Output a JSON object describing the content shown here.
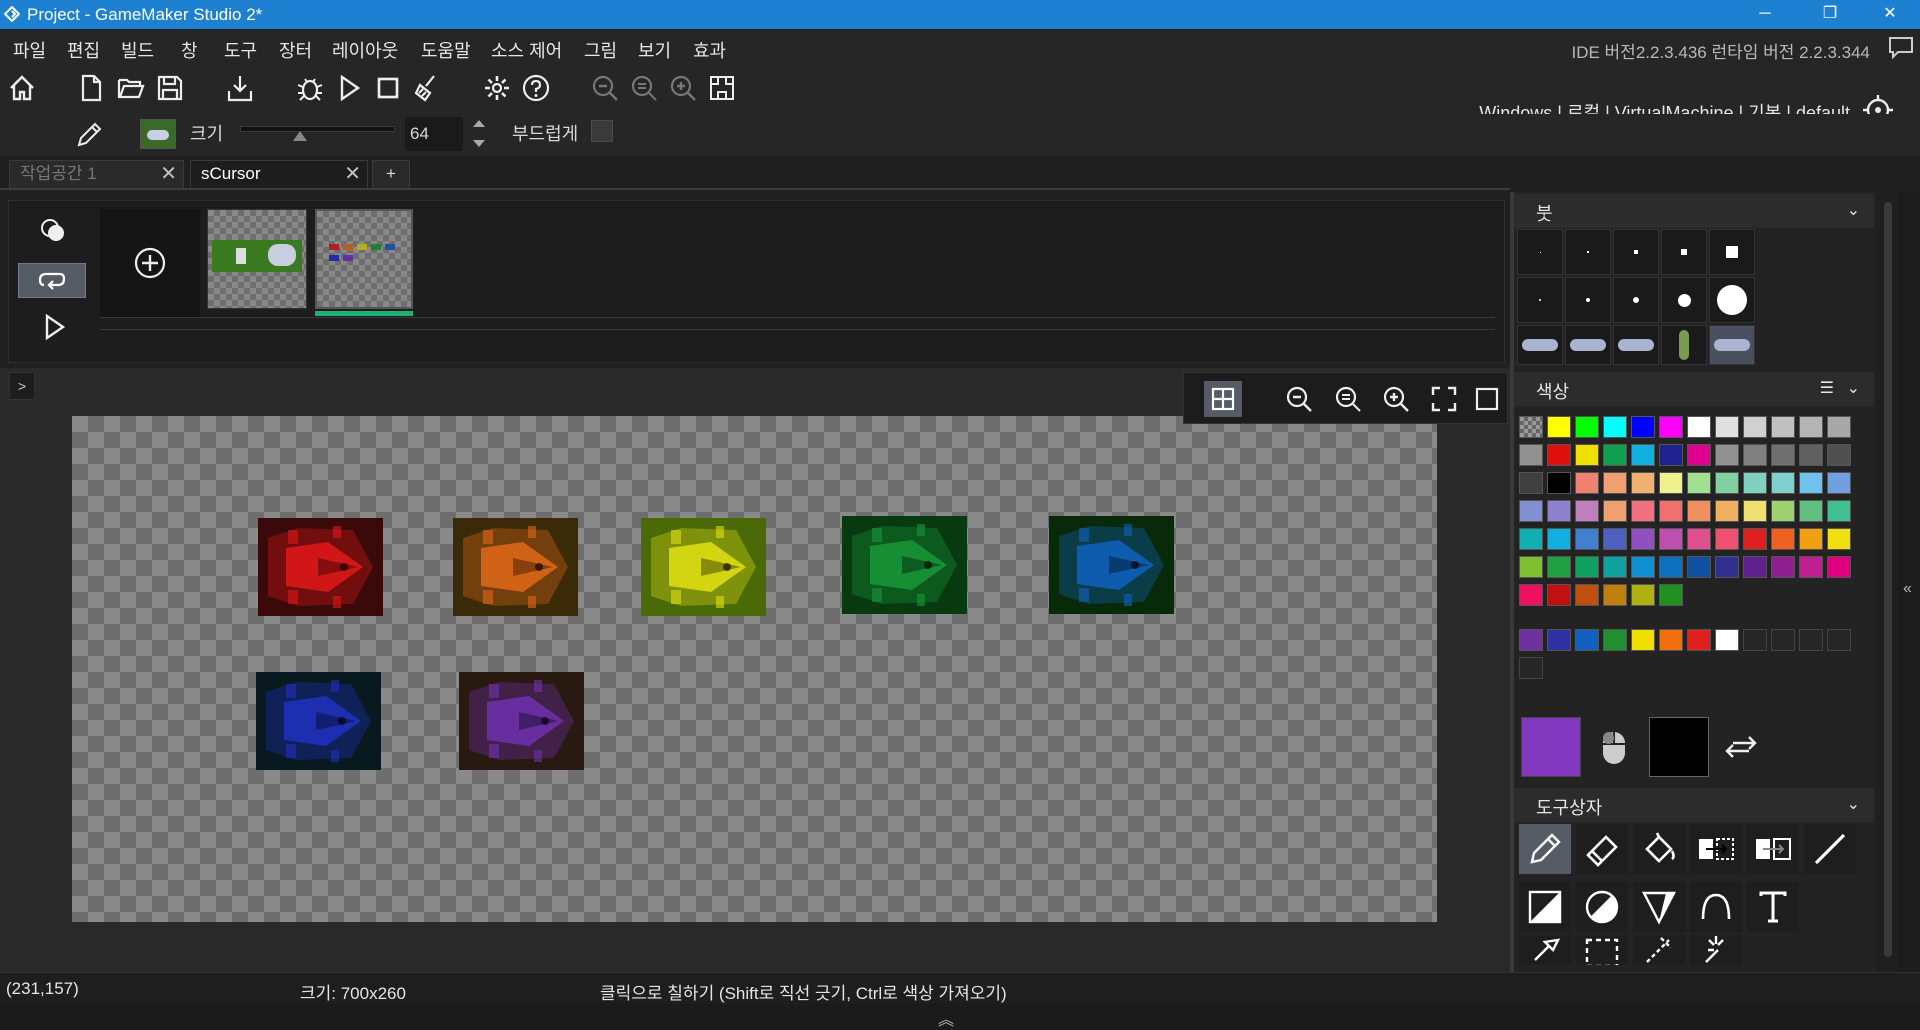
{
  "window": {
    "title": "Project - GameMaker Studio 2*",
    "minimize": "─",
    "maximize": "❐",
    "close": "✕"
  },
  "menu": [
    "파일",
    "편집",
    "빌드",
    "창",
    "도구",
    "장터",
    "레이아웃",
    "도움말",
    "소스 제어",
    "그림",
    "보기",
    "효과"
  ],
  "version_text": "IDE 버전2.2.3.436 런타임 버전 2.2.3.344",
  "target_bar": "Windows | 로컬 | VirtualMachine | 기본 | default",
  "options": {
    "size_label": "크기",
    "size_value": "64",
    "size_slider_fraction": 0.38,
    "smooth_label": "부드럽게"
  },
  "tabs": [
    {
      "label": "작업공간 1",
      "active": false
    },
    {
      "label": "sCursor",
      "active": true
    }
  ],
  "add_tab": "+",
  "panels": {
    "brush_title": "붓",
    "color_title": "색상",
    "toolbox_title": "도구상자"
  },
  "colors": {
    "primary": "#8338C0",
    "secondary": "#000000",
    "palette_rows": [
      [
        "transparent",
        "#FFFF00",
        "#00FF00",
        "#00FFFF",
        "#0000FF",
        "#FF00FF",
        "#FFFFFF",
        "#E0E0E0",
        "#D0D0D0",
        "#C0C0C0",
        "#B4B4B4",
        "#A8A8A8"
      ],
      [
        "#909090",
        "#E01010",
        "#F0E000",
        "#10A050",
        "#10B0E0",
        "#202090",
        "#E00090",
        "#909090",
        "#808080",
        "#707070",
        "#606060",
        "#505050"
      ],
      [
        "#404040",
        "#000000",
        "#F08070",
        "#F0A070",
        "#F0B070",
        "#F0F090",
        "#A0E090",
        "#80D0A0",
        "#80D0C0",
        "#80D0D0",
        "#70C0F0",
        "#70A0E0"
      ],
      [
        "#8090D0",
        "#9080D0",
        "#C080C0",
        "#F0A070",
        "#F07080",
        "#F07070",
        "#F09060",
        "#F0B060",
        "#F0E070",
        "#A0D070",
        "#60C080",
        "#40C090"
      ],
      [
        "#10B0B0",
        "#10B0E0",
        "#4080D0",
        "#5060C0",
        "#9050C0",
        "#C050B0",
        "#E05090",
        "#F05070",
        "#E02020",
        "#F06020",
        "#F0A010",
        "#F0E010"
      ],
      [
        "#80C030",
        "#20A040",
        "#10A060",
        "#10A0A0",
        "#1090D0",
        "#1070C0",
        "#1050A0",
        "#303090",
        "#602090",
        "#902090",
        "#C02090",
        "#E00080"
      ],
      [
        "#F01060",
        "#C01010",
        "#C05010",
        "#C08010",
        "#B0B010",
        "#209020"
      ]
    ],
    "recent": [
      "#7030A0",
      "#3030A0",
      "#1060C0",
      "#209030",
      "#F0E000",
      "#F07010",
      "#E02020",
      "#FFFFFF",
      "",
      "",
      "",
      "",
      ""
    ]
  },
  "status": {
    "coords": "(231,157)",
    "size": "크기: 700x260",
    "hint": "클릭으로 칠하기 (Shift로 직선 긋기, Ctrl로 색상 가져오기)"
  },
  "sprites": [
    {
      "color": "#E01818",
      "bg": "#3a0a0a"
    },
    {
      "color": "#E06818",
      "bg": "#3a2a08"
    },
    {
      "color": "#E0E010",
      "bg": "#4a6a08"
    },
    {
      "color": "#189838",
      "bg": "#083a10"
    },
    {
      "color": "#1060C0",
      "bg": "#082a0a"
    },
    {
      "color": "#2030C0",
      "bg": "#081a20"
    },
    {
      "color": "#7030B0",
      "bg": "#281a10"
    }
  ],
  "tool_names": [
    "pencil",
    "eraser",
    "fill",
    "selection-move",
    "selection-copy",
    "line",
    "rectangle",
    "ellipse",
    "polygon",
    "curve",
    "text",
    "eyedropper",
    "select-rect",
    "select-lasso",
    "magic-wand"
  ]
}
